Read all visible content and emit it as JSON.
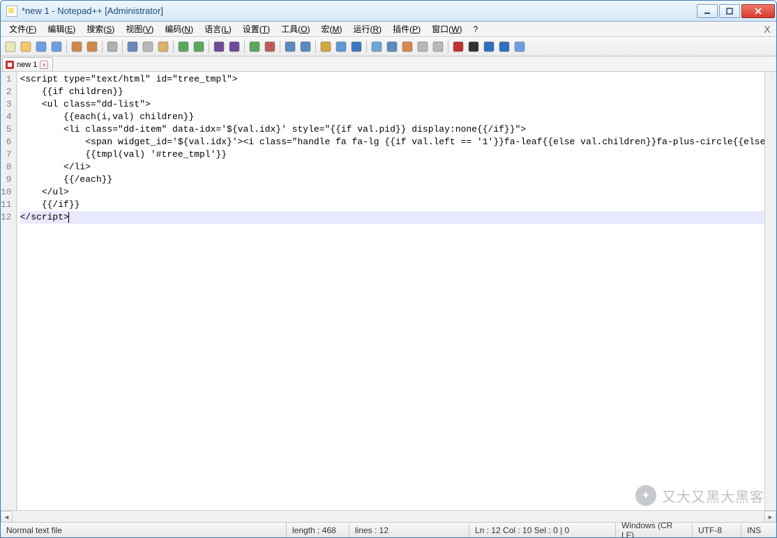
{
  "titlebar": {
    "title": "*new 1 - Notepad++ [Administrator]"
  },
  "menu": {
    "items": [
      {
        "label": "文件",
        "accel": "F"
      },
      {
        "label": "编辑",
        "accel": "E"
      },
      {
        "label": "搜索",
        "accel": "S"
      },
      {
        "label": "视图",
        "accel": "V"
      },
      {
        "label": "编码",
        "accel": "N"
      },
      {
        "label": "语言",
        "accel": "L"
      },
      {
        "label": "设置",
        "accel": "T"
      },
      {
        "label": "工具",
        "accel": "O"
      },
      {
        "label": "宏",
        "accel": "M"
      },
      {
        "label": "运行",
        "accel": "R"
      },
      {
        "label": "插件",
        "accel": "P"
      },
      {
        "label": "窗口",
        "accel": "W"
      },
      {
        "label": "?",
        "accel": ""
      }
    ]
  },
  "toolbar_icons": [
    "new-file-icon",
    "open-icon",
    "save-icon",
    "save-all-icon",
    "sep",
    "close-icon",
    "close-all-icon",
    "sep",
    "print-icon",
    "sep",
    "cut-icon",
    "copy-icon",
    "paste-icon",
    "sep",
    "undo-icon",
    "redo-icon",
    "sep",
    "find-icon",
    "replace-icon",
    "sep",
    "zoom-in-icon",
    "zoom-out-icon",
    "sep",
    "sync-v-icon",
    "sync-h-icon",
    "sep",
    "wordwrap-icon",
    "show-all-icon",
    "indent-guide-icon",
    "sep",
    "lang-icon",
    "monitor-icon",
    "doc-map-icon",
    "func-list-icon",
    "folder-icon",
    "sep",
    "record-icon",
    "stop-icon",
    "play-icon",
    "play-multi-icon",
    "save-macro-icon"
  ],
  "tab": {
    "name": "new 1"
  },
  "code": {
    "lines": [
      "<script type=\"text/html\" id=\"tree_tmpl\">",
      "    {{if children}}",
      "    <ul class=\"dd-list\">",
      "        {{each(i,val) children}}",
      "        <li class=\"dd-item\" data-idx='${val.idx}' style=\"{{if val.pid}} display:none{{/if}}\">",
      "            <span widget_id='${val.idx}'><i class=\"handle fa fa-lg {{if val.left == '1'}}fa-leaf{{else val.children}}fa-plus-circle{{else}}fa-pencil-square-o{{/if}}\"></i><b>${val.name}</b></span>",
      "            {{tmpl(val) '#tree_tmpl'}}",
      "        </li>",
      "        {{/each}}",
      "    </ul>",
      "    {{/if}}",
      "</script>"
    ],
    "current_line": 12
  },
  "status": {
    "filetype": "Normal text file",
    "length": "length : 468",
    "lines": "lines : 12",
    "pos": "Ln : 12    Col : 10    Sel : 0 | 0",
    "eol": "Windows (CR LF)",
    "encoding": "UTF-8",
    "ovr": "INS"
  },
  "watermark": {
    "text": "又大又黑大黑客"
  }
}
